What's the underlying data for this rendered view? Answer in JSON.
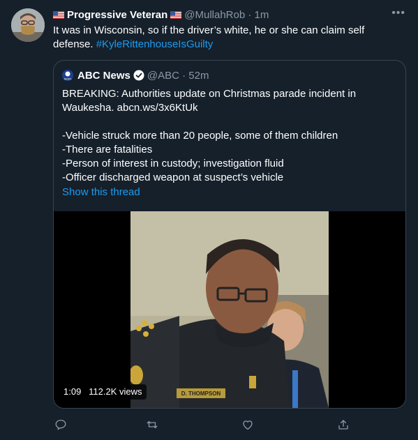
{
  "tweet": {
    "author_name": "Progressive Veteran",
    "handle": "@MullahRob",
    "separator": "·",
    "time": "1m",
    "text": "It was in Wisconsin, so if the driver’s white, he or she can claim self defense.",
    "hashtag": "#KyleRittenhouseIsGuilty",
    "more_label": "•••"
  },
  "quote": {
    "author_name": "ABC News",
    "handle": "@ABC",
    "separator": "·",
    "time": "52m",
    "logo_text": "NEWS",
    "lines": [
      "BREAKING: Authorities update on Christmas parade incident in",
      "Waukesha. abcn.ws/3x6KtUk",
      "",
      "-Vehicle struck more than 20 people, some of them children",
      "-There are fatalities",
      "-Person of interest in custody; investigation fluid",
      "-Officer discharged weapon at suspect’s vehicle"
    ],
    "show_thread": "Show this thread",
    "video": {
      "duration": "1:09",
      "views": "112.2K views",
      "name_tag": "D. THOMPSON"
    }
  },
  "colors": {
    "background": "#15202b",
    "link": "#1d9bf0",
    "muted": "#8b98a5",
    "border": "#38444d"
  },
  "icons": [
    "reply-icon",
    "retweet-icon",
    "like-icon",
    "share-icon",
    "verified-badge-icon",
    "us-flag-icon"
  ]
}
